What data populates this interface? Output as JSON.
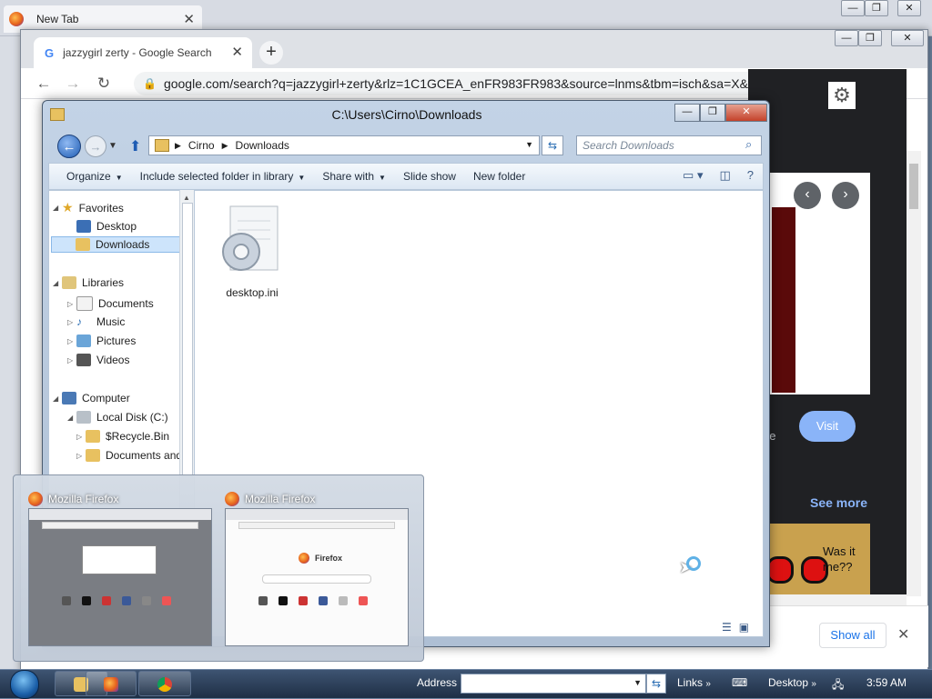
{
  "firefox_bg": {
    "tab_title": "New Tab"
  },
  "chrome": {
    "tab_title": "jazzygirl zerty - Google Search",
    "url": "google.com/search?q=jazzygirl+zerty&rlz=1C1GCEA_enFR983FR983&source=lnms&tbm=isch&sa=X&ved=2a...",
    "visit_label": "Visit",
    "be_text": "be",
    "see_more_label": "See more",
    "image_caption": "Was it\nme??",
    "show_all_label": "Show all"
  },
  "explorer": {
    "title": "C:\\Users\\Cirno\\Downloads",
    "breadcrumb": [
      "Cirno",
      "Downloads"
    ],
    "search_placeholder": "Search Downloads",
    "commands": [
      "Organize",
      "Include selected folder in library",
      "Share with",
      "Slide show",
      "New folder"
    ],
    "nav": {
      "favorites": "Favorites",
      "desktop": "Desktop",
      "downloads": "Downloads",
      "libraries": "Libraries",
      "documents": "Documents",
      "music": "Music",
      "pictures": "Pictures",
      "videos": "Videos",
      "computer": "Computer",
      "local_disk": "Local Disk (C:)",
      "recycle_bin": "$Recycle.Bin",
      "documents_and": "Documents and"
    },
    "files": [
      {
        "name": "desktop.ini",
        "icon": "settings-file-icon"
      }
    ]
  },
  "flyout": {
    "windows": [
      {
        "title": "Mozilla Firefox"
      },
      {
        "title": "Mozilla Firefox",
        "brand": "Firefox"
      }
    ]
  },
  "taskbar": {
    "address_label": "Address",
    "links_label": "Links",
    "desktop_label": "Desktop",
    "clock": "3:59 AM"
  },
  "colors": {
    "accent": "#1e5cb3",
    "chrome_dark": "#202124",
    "visit": "#8ab4f8"
  }
}
